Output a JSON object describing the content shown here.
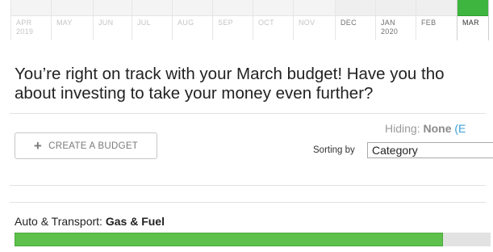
{
  "timeline": {
    "months": [
      {
        "label": "APR",
        "year": "2019",
        "state": "past"
      },
      {
        "label": "MAY",
        "year": "",
        "state": "past"
      },
      {
        "label": "JUN",
        "year": "",
        "state": "past"
      },
      {
        "label": "JUL",
        "year": "",
        "state": "past"
      },
      {
        "label": "AUG",
        "year": "",
        "state": "past"
      },
      {
        "label": "SEP",
        "year": "",
        "state": "past"
      },
      {
        "label": "OCT",
        "year": "",
        "state": "past"
      },
      {
        "label": "NOV",
        "year": "",
        "state": "past"
      },
      {
        "label": "DEC",
        "year": "",
        "state": "recent"
      },
      {
        "label": "JAN",
        "year": "2020",
        "state": "recent"
      },
      {
        "label": "FEB",
        "year": "",
        "state": "recent"
      },
      {
        "label": "MAR",
        "year": "",
        "state": "active"
      }
    ]
  },
  "message": {
    "line1": "You’re right on track with your March budget! Have you tho",
    "line2": "about investing to take your money even further?"
  },
  "hiding": {
    "label": "Hiding:",
    "value": "None",
    "link": "(E"
  },
  "actions": {
    "create_budget": "CREATE A BUDGET"
  },
  "sorting": {
    "label": "Sorting by",
    "selected": "Category"
  },
  "budget_item": {
    "category": "Auto & Transport:",
    "subcategory": "Gas & Fuel",
    "progress_fraction": 0.9
  },
  "colors": {
    "accent_green": "#3db53f",
    "progress_green": "#5ec14c",
    "link_blue": "#3aa0d8"
  }
}
